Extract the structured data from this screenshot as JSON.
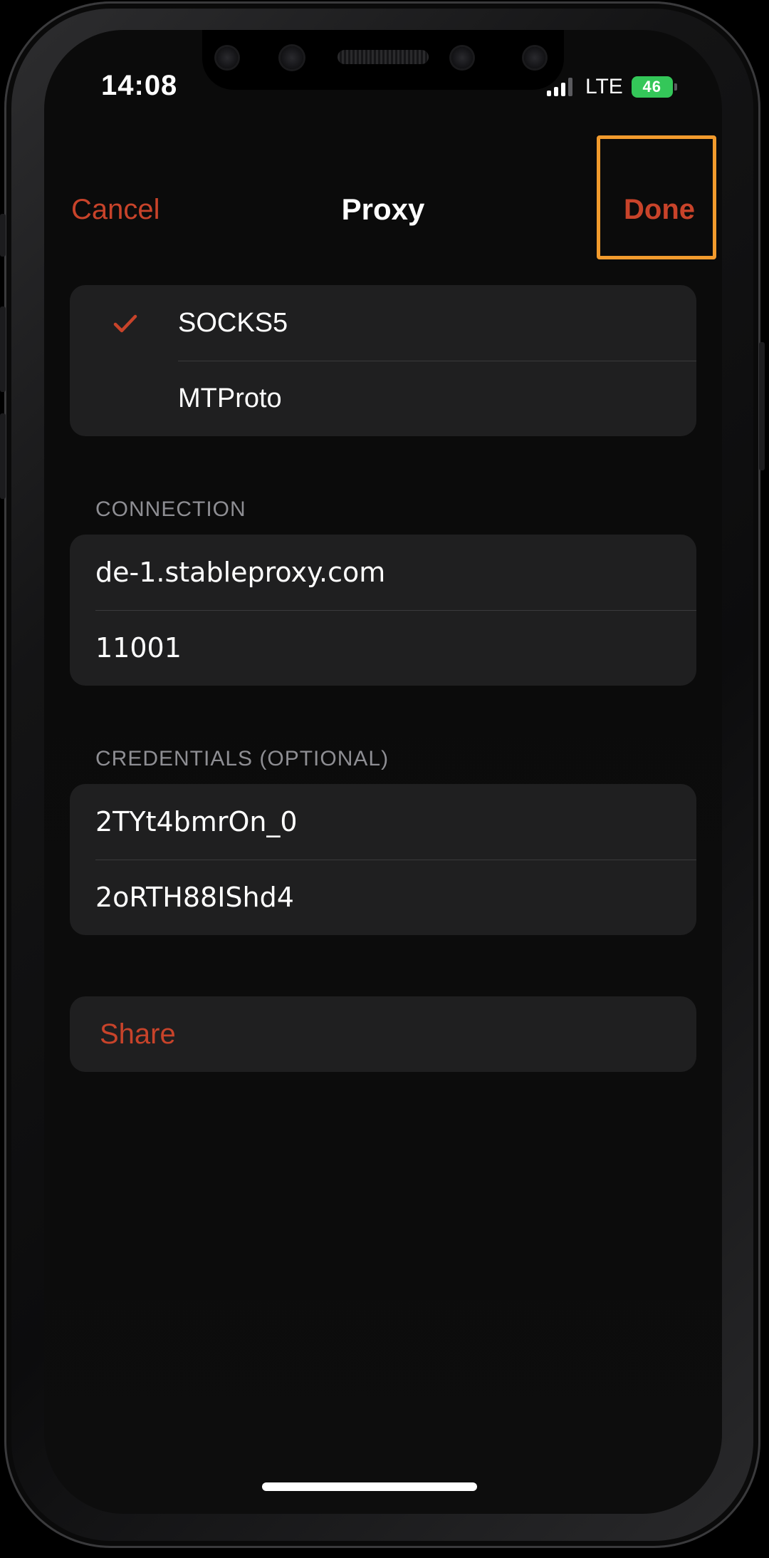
{
  "status_bar": {
    "time": "14:08",
    "network": "LTE",
    "battery": "46"
  },
  "nav": {
    "cancel_label": "Cancel",
    "title": "Proxy",
    "done_label": "Done"
  },
  "proxy_types": [
    {
      "label": "SOCKS5",
      "selected": true
    },
    {
      "label": "MTProto",
      "selected": false
    }
  ],
  "connection": {
    "header": "CONNECTION",
    "server": "de-1.stableproxy.com",
    "port": "11001"
  },
  "credentials": {
    "header": "CREDENTIALS (OPTIONAL)",
    "username": "2TYt4bmrOn_0",
    "password": "2oRTH88IShd4"
  },
  "actions": {
    "share_label": "Share"
  },
  "colors": {
    "accent": "#c8432a",
    "highlight": "#f29b2d",
    "cell_background": "#1f1f20",
    "screen_background": "#0b0b0b",
    "battery": "#34c759"
  },
  "icons": {
    "selected": "checkmark-icon"
  }
}
